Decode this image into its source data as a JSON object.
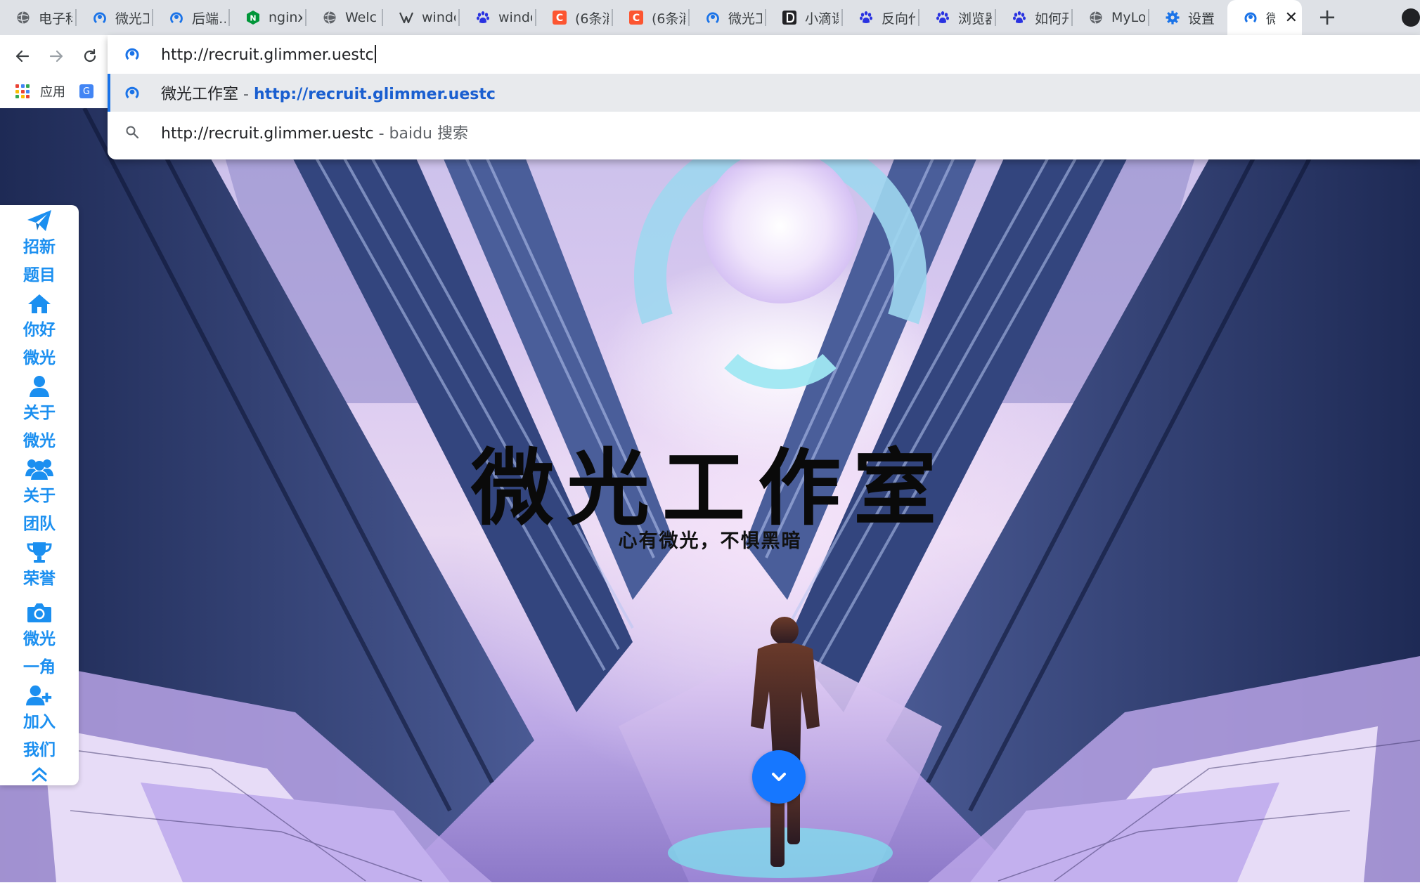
{
  "browser": {
    "tabs": [
      {
        "title": "电子科",
        "icon": "globe-icon",
        "color": "#5f6368"
      },
      {
        "title": "微光工",
        "icon": "glimmer-logo-icon",
        "color": "#1a73e8"
      },
      {
        "title": "后端…",
        "icon": "glimmer-logo-icon",
        "color": "#1a73e8"
      },
      {
        "title": "nginx",
        "icon": "nginx-icon",
        "color": "#009639"
      },
      {
        "title": "Welc",
        "icon": "globe-icon",
        "color": "#5f6368"
      },
      {
        "title": "windo",
        "icon": "windows-icon",
        "color": "#3c4043"
      },
      {
        "title": "windo",
        "icon": "baidu-paw-icon",
        "color": "#2932e1"
      },
      {
        "title": "(6条消",
        "icon": "csdn-icon",
        "color": "#fc5531"
      },
      {
        "title": "(6条消",
        "icon": "csdn-icon",
        "color": "#fc5531"
      },
      {
        "title": "微光工",
        "icon": "glimmer-logo-icon",
        "color": "#1a73e8"
      },
      {
        "title": "小滴课",
        "icon": "xiaodi-icon",
        "color": "#202124"
      },
      {
        "title": "反向代",
        "icon": "baidu-paw-icon",
        "color": "#2932e1"
      },
      {
        "title": "浏览器",
        "icon": "baidu-paw-icon",
        "color": "#2932e1"
      },
      {
        "title": "如何开",
        "icon": "baidu-paw-icon",
        "color": "#2932e1"
      },
      {
        "title": "MyLo",
        "icon": "globe-icon",
        "color": "#5f6368"
      },
      {
        "title": "设置",
        "icon": "settings-gear-icon",
        "color": "#1a73e8"
      }
    ],
    "active_tab": {
      "title": "微",
      "close": "✕"
    },
    "new_tab": "+",
    "bookmarks": {
      "apps_label": "应用"
    },
    "omnibox": {
      "input_value": "http://recruit.glimmer.uestc",
      "suggestions": [
        {
          "title": "微光工作室",
          "separator": " - ",
          "url": "http://recruit.glimmer.uestc"
        },
        {
          "query": "http://recruit.glimmer.uestc",
          "separator": " - ",
          "engine": "baidu 搜索"
        }
      ]
    }
  },
  "sidenav": {
    "items": [
      {
        "icon": "paper-plane-icon",
        "line1": "招新",
        "line2": "题目"
      },
      {
        "icon": "home-icon",
        "line1": "你好",
        "line2": "微光"
      },
      {
        "icon": "user-icon",
        "line1": "关于",
        "line2": "微光"
      },
      {
        "icon": "users-icon",
        "line1": "关于",
        "line2": "团队"
      },
      {
        "icon": "trophy-icon",
        "line1": "荣誉",
        "line2": ""
      },
      {
        "icon": "camera-icon",
        "line1": "微光",
        "line2": "一角"
      },
      {
        "icon": "add-user-icon",
        "line1": "加入",
        "line2": "我们"
      }
    ],
    "to_top_icon": "double-chevron-up-icon"
  },
  "hero": {
    "title": "微光工作室",
    "subtitle": "心有微光，不惧黑暗",
    "scroll_icon": "chevron-down-icon"
  },
  "colors": {
    "accent": "#1677ff",
    "nav_text": "#1b8ff0",
    "omnibox_link": "#1a5fd0",
    "tabstrip": "#dee1e6"
  }
}
